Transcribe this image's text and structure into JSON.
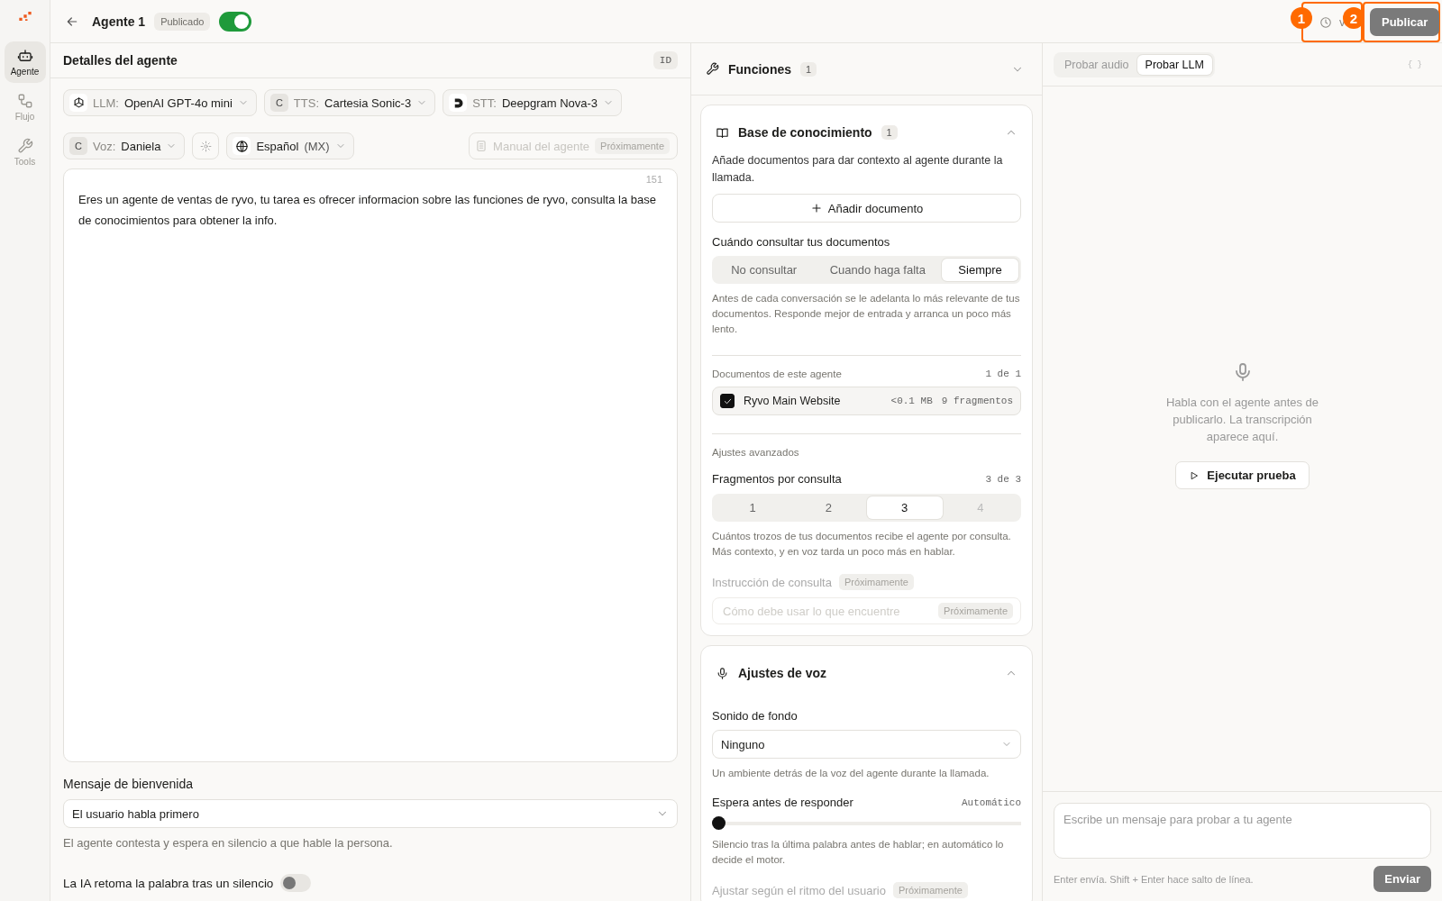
{
  "sidebar": {
    "items": [
      {
        "kind": "agent",
        "label": "Agente",
        "selected": true
      },
      {
        "kind": "flow",
        "label": "Flujo",
        "selected": false
      },
      {
        "kind": "tools",
        "label": "Tools",
        "selected": false
      }
    ]
  },
  "header": {
    "title": "Agente 1",
    "status": "Publicado",
    "published_on": true,
    "version": "v",
    "publish_button": "Publicar"
  },
  "callouts": [
    {
      "label": "1"
    },
    {
      "label": "2"
    }
  ],
  "details": {
    "title": "Detalles del agente",
    "id_button": "ID",
    "chips": [
      {
        "kind": "llm",
        "label": "LLM:",
        "value": "OpenAI GPT-4o mini"
      },
      {
        "kind": "tts",
        "badge": "C",
        "label": "TTS:",
        "value": "Cartesia Sonic-3"
      },
      {
        "kind": "stt",
        "label": "STT:",
        "value": "Deepgram Nova-3"
      },
      {
        "kind": "voice",
        "badge": "C",
        "label": "Voz:",
        "value": "Daniela"
      },
      {
        "kind": "settings"
      },
      {
        "kind": "language",
        "value": "Español",
        "extra": "(MX)"
      }
    ],
    "manual": {
      "label": "Manual del agente",
      "badge": "Próximamente",
      "disabled": true
    },
    "prompt": {
      "text": "Eres un agente de ventas de ryvo, tu tarea es ofrecer informacion sobre las funciones de ryvo, consulta la base de conocimientos para obtener la info.",
      "count": "151"
    },
    "welcome": {
      "label": "Mensaje de bienvenida",
      "value": "El usuario habla primero",
      "hint": "El agente contesta y espera en silencio a que hable la persona."
    },
    "resume_toggle": {
      "label": "La IA retoma la palabra tras un silencio",
      "on": false
    }
  },
  "functions": {
    "title": "Funciones",
    "count": "1",
    "expanded": false
  },
  "knowledge": {
    "title": "Base de conocimiento",
    "count": "1",
    "expanded": true,
    "description": "Añade documentos para dar contexto al agente durante la llamada.",
    "add_button": "Añadir documento",
    "mode_label": "Cuándo consultar tus documentos",
    "modes": [
      {
        "label": "No consultar",
        "selected": false
      },
      {
        "label": "Cuando haga falta",
        "selected": false
      },
      {
        "label": "Siempre",
        "selected": true
      }
    ],
    "mode_hint": "Antes de cada conversación se le adelanta lo más relevante de tus documentos. Responde mejor de entrada y arranca un poco más lento.",
    "documents_label": "Documentos de este agente",
    "documents_count": "1 de 1",
    "documents": [
      {
        "name": "Ryvo Main Website",
        "checked": true,
        "size": "<0.1 MB",
        "fragments": "9 fragmentos"
      }
    ],
    "advanced_label": "Ajustes avanzados",
    "fragments_label": "Fragmentos por consulta",
    "fragments_count": "3 de 3",
    "fragment_options": [
      {
        "label": "1",
        "selected": false,
        "disabled": false
      },
      {
        "label": "2",
        "selected": false,
        "disabled": false
      },
      {
        "label": "3",
        "selected": true,
        "disabled": false
      },
      {
        "label": "4",
        "selected": false,
        "disabled": true
      }
    ],
    "fragments_hint": "Cuántos trozos de tus documentos recibe el agente por consulta. Más contexto, y en voz tarda un poco más en hablar.",
    "instruction_label": "Instrucción de consulta",
    "instruction_badge": "Próximamente",
    "instruction_placeholder": "Cómo debe usar lo que encuentre",
    "instruction_field_badge": "Próximamente"
  },
  "voice": {
    "title": "Ajustes de voz",
    "expanded": true,
    "background_label": "Sonido de fondo",
    "background_value": "Ninguno",
    "background_hint": "Un ambiente detrás de la voz del agente durante la llamada.",
    "wait_label": "Espera antes de responder",
    "wait_value": "Automático",
    "wait_slider": {
      "level": 0
    },
    "wait_hint": "Silencio tras la última palabra antes de hablar; en automático lo decide el motor.",
    "adapt_label": "Ajustar según el ritmo del usuario",
    "adapt_badge": "Próximamente"
  },
  "test": {
    "tabs": [
      {
        "label": "Probar audio",
        "selected": false
      },
      {
        "label": "Probar LLM",
        "selected": true
      }
    ],
    "json_button": "{ }",
    "empty_text": "Habla con el agente antes de publicarlo. La transcripción aparece aquí.",
    "run_button": "Ejecutar prueba",
    "input": {
      "placeholder": "Escribe un mensaje para probar a tu agente"
    },
    "hint": "Enter envía. Shift + Enter hace salto de línea.",
    "send_button": "Enviar"
  }
}
